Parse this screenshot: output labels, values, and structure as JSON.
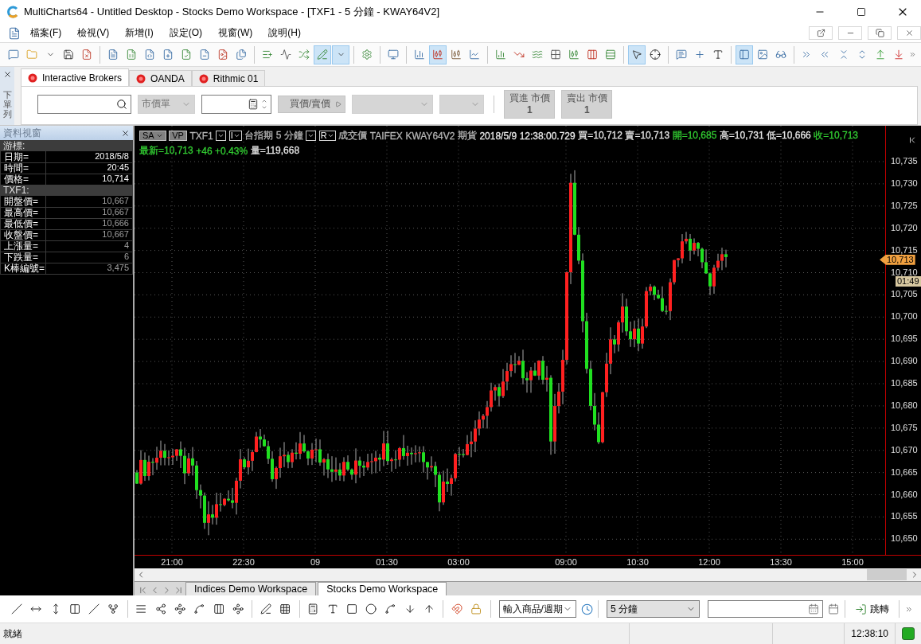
{
  "window": {
    "title": "MultiCharts64 - Untitled Desktop - Stocks Demo Workspace - [TXF1 - 5 分鐘 - KWAY64V2]"
  },
  "menu": [
    "檔案(F)",
    "檢視(V)",
    "新增(I)",
    "設定(O)",
    "視窗(W)",
    "說明(H)"
  ],
  "main_toolbar": [
    {
      "kind": "button",
      "selected": false
    },
    {
      "kind": "button",
      "selected": false
    },
    {
      "kind": "button",
      "selected": false
    },
    {
      "kind": "button",
      "selected": false
    },
    {
      "kind": "button",
      "selected": false
    },
    {
      "kind": "separator"
    },
    {
      "kind": "button",
      "selected": false
    },
    {
      "kind": "button",
      "selected": false
    },
    {
      "kind": "button",
      "selected": false
    },
    {
      "kind": "button",
      "selected": false
    },
    {
      "kind": "button",
      "selected": false
    },
    {
      "kind": "button",
      "selected": false
    },
    {
      "kind": "button",
      "selected": false
    },
    {
      "kind": "button",
      "selected": false
    },
    {
      "kind": "separator"
    },
    {
      "kind": "button",
      "selected": false
    },
    {
      "kind": "button",
      "selected": false
    },
    {
      "kind": "button",
      "selected": false
    },
    {
      "kind": "button",
      "selected": true
    },
    {
      "kind": "button",
      "selected": true
    },
    {
      "kind": "separator"
    },
    {
      "kind": "button",
      "selected": false
    },
    {
      "kind": "separator"
    },
    {
      "kind": "button",
      "selected": false
    },
    {
      "kind": "separator"
    },
    {
      "kind": "button",
      "selected": false
    },
    {
      "kind": "button",
      "selected": true
    },
    {
      "kind": "button",
      "selected": false
    },
    {
      "kind": "button",
      "selected": false
    },
    {
      "kind": "separator"
    },
    {
      "kind": "button",
      "selected": false
    },
    {
      "kind": "button",
      "selected": false
    },
    {
      "kind": "button",
      "selected": false
    },
    {
      "kind": "button",
      "selected": false
    },
    {
      "kind": "button",
      "selected": false
    },
    {
      "kind": "button",
      "selected": false
    },
    {
      "kind": "button",
      "selected": false
    },
    {
      "kind": "separator"
    },
    {
      "kind": "button",
      "selected": true
    },
    {
      "kind": "button",
      "selected": false
    },
    {
      "kind": "separator"
    },
    {
      "kind": "button",
      "selected": false
    },
    {
      "kind": "button",
      "selected": false
    },
    {
      "kind": "button",
      "selected": false
    },
    {
      "kind": "separator"
    },
    {
      "kind": "button",
      "selected": true
    },
    {
      "kind": "button",
      "selected": false
    },
    {
      "kind": "button",
      "selected": false
    },
    {
      "kind": "separator"
    },
    {
      "kind": "button",
      "selected": false
    },
    {
      "kind": "button",
      "selected": false
    },
    {
      "kind": "button",
      "selected": false
    },
    {
      "kind": "button",
      "selected": false
    },
    {
      "kind": "button",
      "selected": false
    },
    {
      "kind": "button",
      "selected": false
    }
  ],
  "order_bar": {
    "side_label": "下單列",
    "tabs": [
      {
        "label": "Interactive Brokers",
        "selected": true
      },
      {
        "label": "OANDA",
        "selected": false
      },
      {
        "label": "Rithmic 01",
        "selected": false
      }
    ],
    "order_type": {
      "value": "市價單",
      "disabled": true
    },
    "price_source": {
      "label": "買價/賣價"
    },
    "selects": [
      {
        "disabled": true
      },
      {
        "disabled": true
      }
    ],
    "order_buttons": [
      {
        "label": "買進 市價",
        "quantity": "1"
      },
      {
        "label": "賣出 市價",
        "quantity": "1"
      }
    ]
  },
  "data_window": {
    "title": "資料視窗",
    "sections": [
      {
        "kind": "cursor",
        "title": "游標:",
        "rows": [
          {
            "label": "日期=",
            "value": "2018/5/8"
          },
          {
            "label": "時間=",
            "value": "20:45"
          },
          {
            "label": "價格=",
            "value": "10,714"
          }
        ]
      },
      {
        "kind": "symbol",
        "title": "TXF1:",
        "rows": [
          {
            "label": "開盤價=",
            "value": "10,667"
          },
          {
            "label": "最高價=",
            "value": "10,667"
          },
          {
            "label": "最低價=",
            "value": "10,666"
          },
          {
            "label": "收盤價=",
            "value": "10,667"
          },
          {
            "label": "上漲量=",
            "value": "4"
          },
          {
            "label": "下跌量=",
            "value": "6"
          },
          {
            "label": "K棒編號=",
            "value": "3,475"
          }
        ]
      }
    ]
  },
  "chart": {
    "header": [
      {
        "kind": "menu-button",
        "label": "SA"
      },
      {
        "kind": "button",
        "label": "VP"
      },
      {
        "kind": "text",
        "label": "TXF1",
        "color": "#b4b4b4"
      },
      {
        "kind": "dropdown"
      },
      {
        "kind": "dropdown",
        "label": "I"
      },
      {
        "kind": "text",
        "label": "台指期",
        "color": "#b4b4b4"
      },
      {
        "kind": "text",
        "label": "5 分鐘",
        "color": "#b4b4b4"
      },
      {
        "kind": "dropdown"
      },
      {
        "kind": "dropdown",
        "label": "R"
      },
      {
        "kind": "text",
        "label": "成交價",
        "color": "#b4b4b4"
      },
      {
        "kind": "text",
        "label": "TAIFEX",
        "color": "#b4b4b4"
      },
      {
        "kind": "text",
        "label": "KWAY64V2",
        "color": "#b4b4b4"
      },
      {
        "kind": "text",
        "label": "期貨",
        "color": "#b4b4b4"
      },
      {
        "kind": "text",
        "label": "2018/5/9",
        "color": "#e6e6e6"
      },
      {
        "kind": "text",
        "label": "12:38:00.729",
        "color": "#e6e6e6"
      },
      {
        "kind": "text",
        "label": "買=10,712",
        "color": "#e6e6e6"
      },
      {
        "kind": "text",
        "label": "賣=10,713",
        "color": "#e6e6e6"
      },
      {
        "kind": "text",
        "label": "開=10,685",
        "color": "#32cd32"
      },
      {
        "kind": "text",
        "label": "高=10,731",
        "color": "#e6e6e6"
      },
      {
        "kind": "text",
        "label": "低=10,666",
        "color": "#e6e6e6"
      },
      {
        "kind": "text",
        "label": "收=10,713",
        "color": "#32cd32"
      }
    ],
    "quote": [
      {
        "label": "最新=10,713",
        "color": "#32cd32"
      },
      {
        "label": "+46",
        "color": "#32cd32"
      },
      {
        "label": "+0.43%",
        "color": "#32cd32"
      },
      {
        "label": "量=119,668",
        "color": "#e6e6e6"
      }
    ],
    "price_ticks": [
      "10,735",
      "10,730",
      "10,725",
      "10,720",
      "10,715",
      "10,710",
      "10,705",
      "10,700",
      "10,695",
      "10,690",
      "10,685",
      "10,680",
      "10,675",
      "10,670",
      "10,665",
      "10,660",
      "10,655",
      "10,650"
    ],
    "last_price": "10,713",
    "countdown": "01:49",
    "time_labels": [
      "21:00",
      "22:30",
      "09",
      "01:30",
      "03:00",
      "09:00",
      "10:30",
      "12:00",
      "13:30",
      "15:00"
    ]
  },
  "workspace_tabs": [
    {
      "label": "Indices Demo Workspace",
      "selected": false
    },
    {
      "label": "Stocks Demo Workspace",
      "selected": true
    }
  ],
  "drawing_toolbar": [
    {
      "kind": "button"
    },
    {
      "kind": "button"
    },
    {
      "kind": "button"
    },
    {
      "kind": "button"
    },
    {
      "kind": "button"
    },
    {
      "kind": "button"
    },
    {
      "kind": "separator"
    },
    {
      "kind": "button"
    },
    {
      "kind": "button"
    },
    {
      "kind": "button"
    },
    {
      "kind": "button"
    },
    {
      "kind": "button"
    },
    {
      "kind": "button"
    },
    {
      "kind": "separator"
    },
    {
      "kind": "button"
    },
    {
      "kind": "button"
    },
    {
      "kind": "separator"
    },
    {
      "kind": "button"
    },
    {
      "kind": "button"
    },
    {
      "kind": "button"
    },
    {
      "kind": "button"
    },
    {
      "kind": "button"
    },
    {
      "kind": "button"
    },
    {
      "kind": "button"
    },
    {
      "kind": "separator"
    },
    {
      "kind": "button"
    },
    {
      "kind": "button"
    }
  ],
  "symbol_combo": {
    "value": "輸入商品/週期"
  },
  "interval_combo": {
    "value": "5 分鐘"
  },
  "jump_button": {
    "label": "跳轉"
  },
  "status_bar": {
    "message": "就緒",
    "time": "12:38:10",
    "connected": true
  }
}
